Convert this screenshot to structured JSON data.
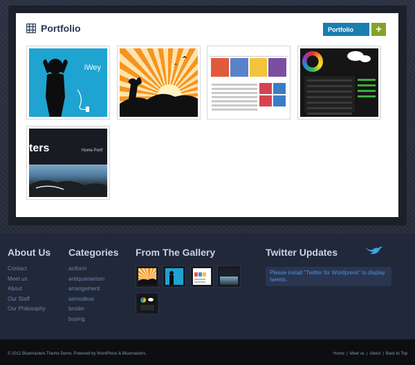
{
  "panel": {
    "title": "Portfolio",
    "filter_label": "Portfolio",
    "add_label": "+"
  },
  "portfolio_items": [
    {
      "label": "iWey"
    },
    {
      "label": ""
    },
    {
      "label": ""
    },
    {
      "label": ""
    },
    {
      "label": "ters",
      "nav": "Home   Portf"
    }
  ],
  "footer": {
    "about": {
      "heading": "About Us",
      "links": [
        "Contact",
        "Meet us",
        "About",
        "Our Staff",
        "Our Philosophy"
      ]
    },
    "categories": {
      "heading": "Categories",
      "links": [
        "aciform",
        "antiquarianism",
        "arrangement",
        "asmodeus",
        "broder",
        "buying"
      ]
    },
    "gallery": {
      "heading": "From The Gallery"
    },
    "twitter": {
      "heading": "Twitter Updates",
      "message": "Please install \"Twitter for Wordpress\" to display tweets.",
      "icon": "bird-icon"
    }
  },
  "bottom": {
    "copyright": "© 2012 Bluemasters Theme Demo. Powered by WordPress & Bluemasters.",
    "links": [
      "Home",
      "Meet us",
      "About",
      "Back to Top"
    ]
  },
  "colors": {
    "accent_blue": "#1a7eb0",
    "accent_green": "#84a32a",
    "footer_bg": "#20283a",
    "link": "#6d84a6"
  }
}
